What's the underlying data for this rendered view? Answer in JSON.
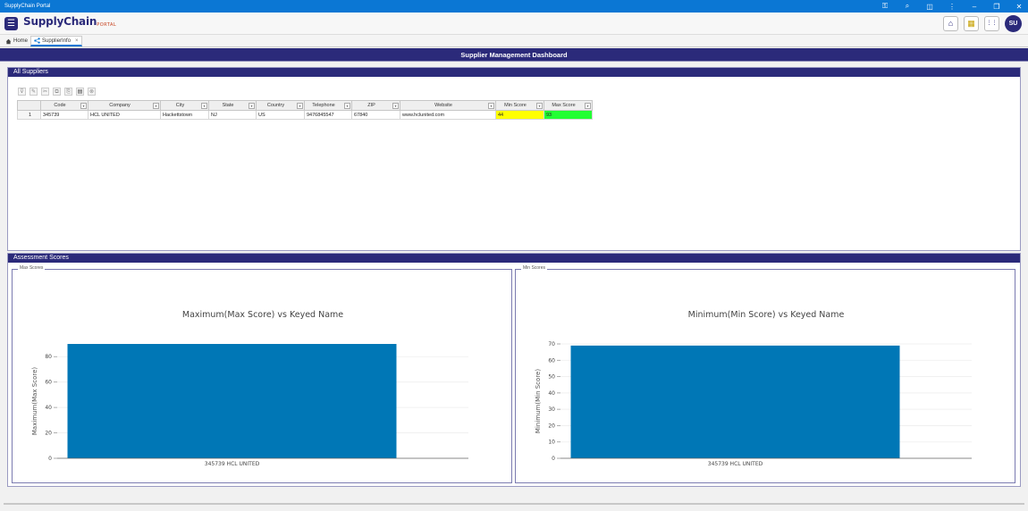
{
  "window": {
    "title": "SupplyChain Portal",
    "controls": [
      "⚿",
      "⌕",
      "◫",
      "⋮",
      "–",
      "❐",
      "✕"
    ]
  },
  "app": {
    "logo_main": "SupplyChain",
    "logo_sub": "PORTAL",
    "avatar_initials": "SU",
    "menu_icon": "☰",
    "home_icon": "⌂",
    "app_icon": "▦",
    "grid_icon": "⋮⋮"
  },
  "tabs": [
    {
      "label": "Home",
      "icon": "home-icon"
    },
    {
      "label": "SupplierInfo",
      "icon": "share-icon",
      "close": "×"
    }
  ],
  "dashboard": {
    "title": "Supplier Management Dashboard"
  },
  "suppliers": {
    "panel_title": "All Suppliers",
    "columns": [
      "Code",
      "Company",
      "City",
      "State",
      "Country",
      "Telephone",
      "ZIP",
      "Website",
      "Min Score",
      "Max Score"
    ],
    "rows": [
      {
        "num": "1",
        "cells": [
          "345739",
          "HCL UNITED",
          "Hackettstown",
          "NJ",
          "US",
          "9476845547",
          "67840",
          "www.hclunited.com",
          "44",
          "93"
        ]
      }
    ]
  },
  "scores": {
    "panel_title": "Assessment Scores"
  },
  "charts": {
    "max": {
      "box_label": "Max Scores"
    },
    "min": {
      "box_label": "Min Scores"
    }
  },
  "chart_data": [
    {
      "type": "bar",
      "title": "Maximum(Max Score) vs Keyed Name",
      "xlabel": "",
      "ylabel": "Maximum(Max Score)",
      "categories": [
        "345739 HCL UNITED"
      ],
      "values": [
        90
      ],
      "ylim": [
        0,
        90
      ],
      "yticks": [
        0,
        20,
        40,
        60,
        80
      ],
      "color": "#0077b6",
      "grid": true
    },
    {
      "type": "bar",
      "title": "Minimum(Min Score) vs Keyed Name",
      "xlabel": "",
      "ylabel": "Minimum(Min Score)",
      "categories": [
        "345739 HCL UNITED"
      ],
      "values": [
        69
      ],
      "ylim": [
        0,
        70
      ],
      "yticks": [
        0,
        10,
        20,
        30,
        40,
        50,
        60,
        70
      ],
      "color": "#0077b6",
      "grid": true
    }
  ]
}
